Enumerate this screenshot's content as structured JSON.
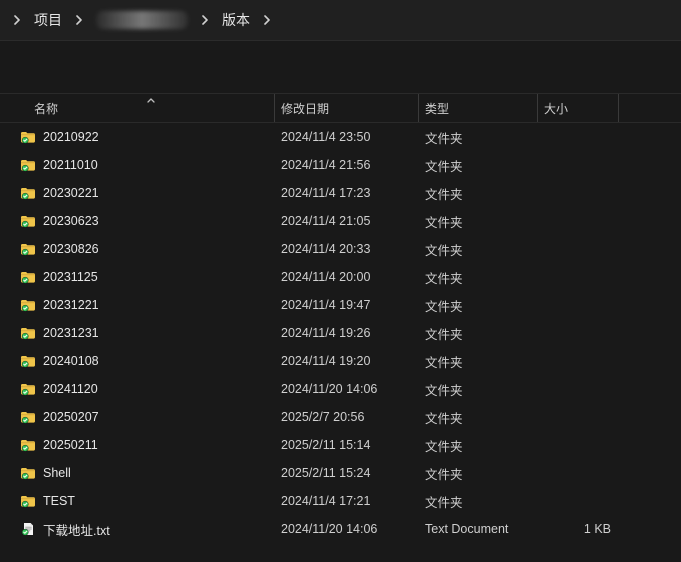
{
  "breadcrumb": {
    "items": [
      {
        "label": "项目"
      },
      {
        "label": ""
      },
      {
        "label": "版本"
      }
    ]
  },
  "columns": {
    "name": "名称",
    "modified": "修改日期",
    "type": "类型",
    "size": "大小"
  },
  "files": [
    {
      "name": "20210922",
      "modified": "2024/11/4 23:50",
      "type": "文件夹",
      "size": ""
    },
    {
      "name": "20211010",
      "modified": "2024/11/4 21:56",
      "type": "文件夹",
      "size": ""
    },
    {
      "name": "20230221",
      "modified": "2024/11/4 17:23",
      "type": "文件夹",
      "size": ""
    },
    {
      "name": "20230623",
      "modified": "2024/11/4 21:05",
      "type": "文件夹",
      "size": ""
    },
    {
      "name": "20230826",
      "modified": "2024/11/4 20:33",
      "type": "文件夹",
      "size": ""
    },
    {
      "name": "20231125",
      "modified": "2024/11/4 20:00",
      "type": "文件夹",
      "size": ""
    },
    {
      "name": "20231221",
      "modified": "2024/11/4 19:47",
      "type": "文件夹",
      "size": ""
    },
    {
      "name": "20231231",
      "modified": "2024/11/4 19:26",
      "type": "文件夹",
      "size": ""
    },
    {
      "name": "20240108",
      "modified": "2024/11/4 19:20",
      "type": "文件夹",
      "size": ""
    },
    {
      "name": "20241120",
      "modified": "2024/11/20 14:06",
      "type": "文件夹",
      "size": ""
    },
    {
      "name": "20250207",
      "modified": "2025/2/7 20:56",
      "type": "文件夹",
      "size": ""
    },
    {
      "name": "20250211",
      "modified": "2025/2/11 15:14",
      "type": "文件夹",
      "size": ""
    },
    {
      "name": "Shell",
      "modified": "2025/2/11 15:24",
      "type": "文件夹",
      "size": ""
    },
    {
      "name": "TEST",
      "modified": "2024/11/4 17:21",
      "type": "文件夹",
      "size": ""
    },
    {
      "name": "下载地址.txt",
      "modified": "2024/11/20 14:06",
      "type": "Text Document",
      "size": "1 KB"
    }
  ],
  "icons": {
    "breadcrumb_separator": "chevron-right-icon",
    "sort": "sort-ascending-icon",
    "folder": "folder-icon",
    "synced_badge": "synced-check-icon",
    "text_file": "text-file-icon"
  }
}
